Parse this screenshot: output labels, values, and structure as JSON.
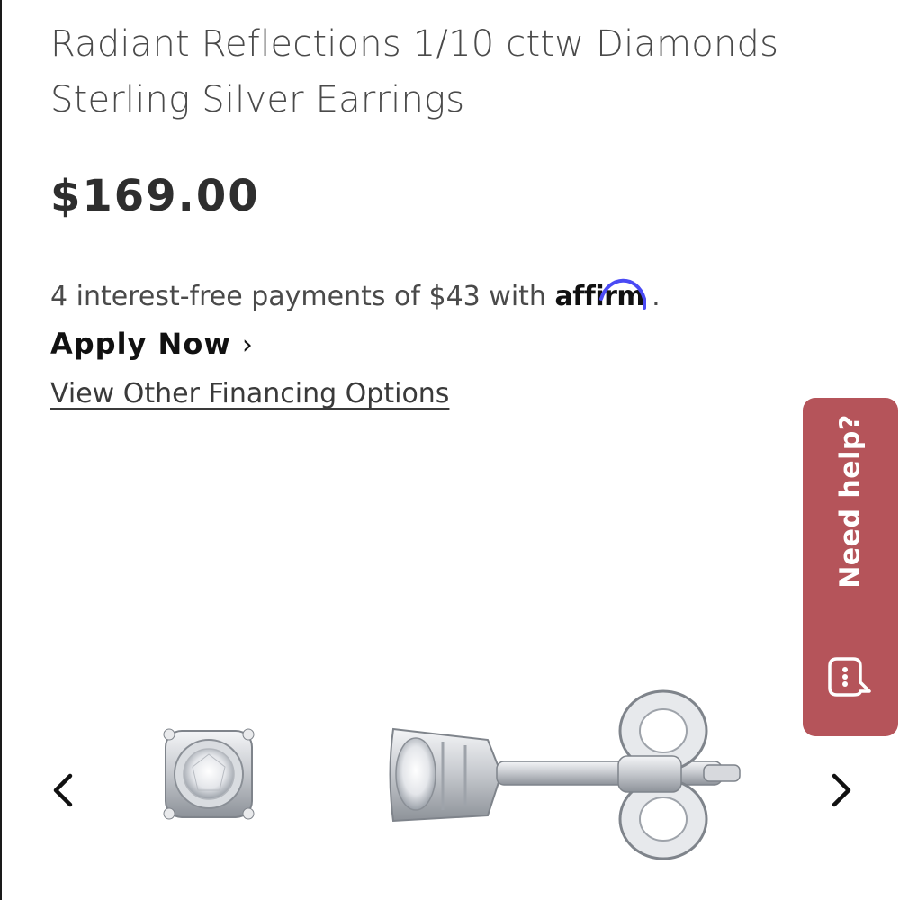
{
  "product": {
    "title": "Radiant Reflections 1/10 cttw Diamonds Sterling Silver Earrings",
    "price": "$169.00"
  },
  "financing": {
    "payments_text": "4 interest-free payments of $43 with",
    "affirm_brand": "affirm",
    "trailing_period": ".",
    "apply_now_label": "Apply Now",
    "apply_now_chevron": "›",
    "view_other_label": "View Other Financing Options"
  },
  "help": {
    "label": "Need help?",
    "icon": "chat-bubble-icon",
    "color": "#b5545a"
  },
  "carousel": {
    "prev_icon": "chevron-left-icon",
    "next_icon": "chevron-right-icon"
  },
  "colors": {
    "affirm_arc": "#4a4af4",
    "text": "#3a3a3a"
  }
}
